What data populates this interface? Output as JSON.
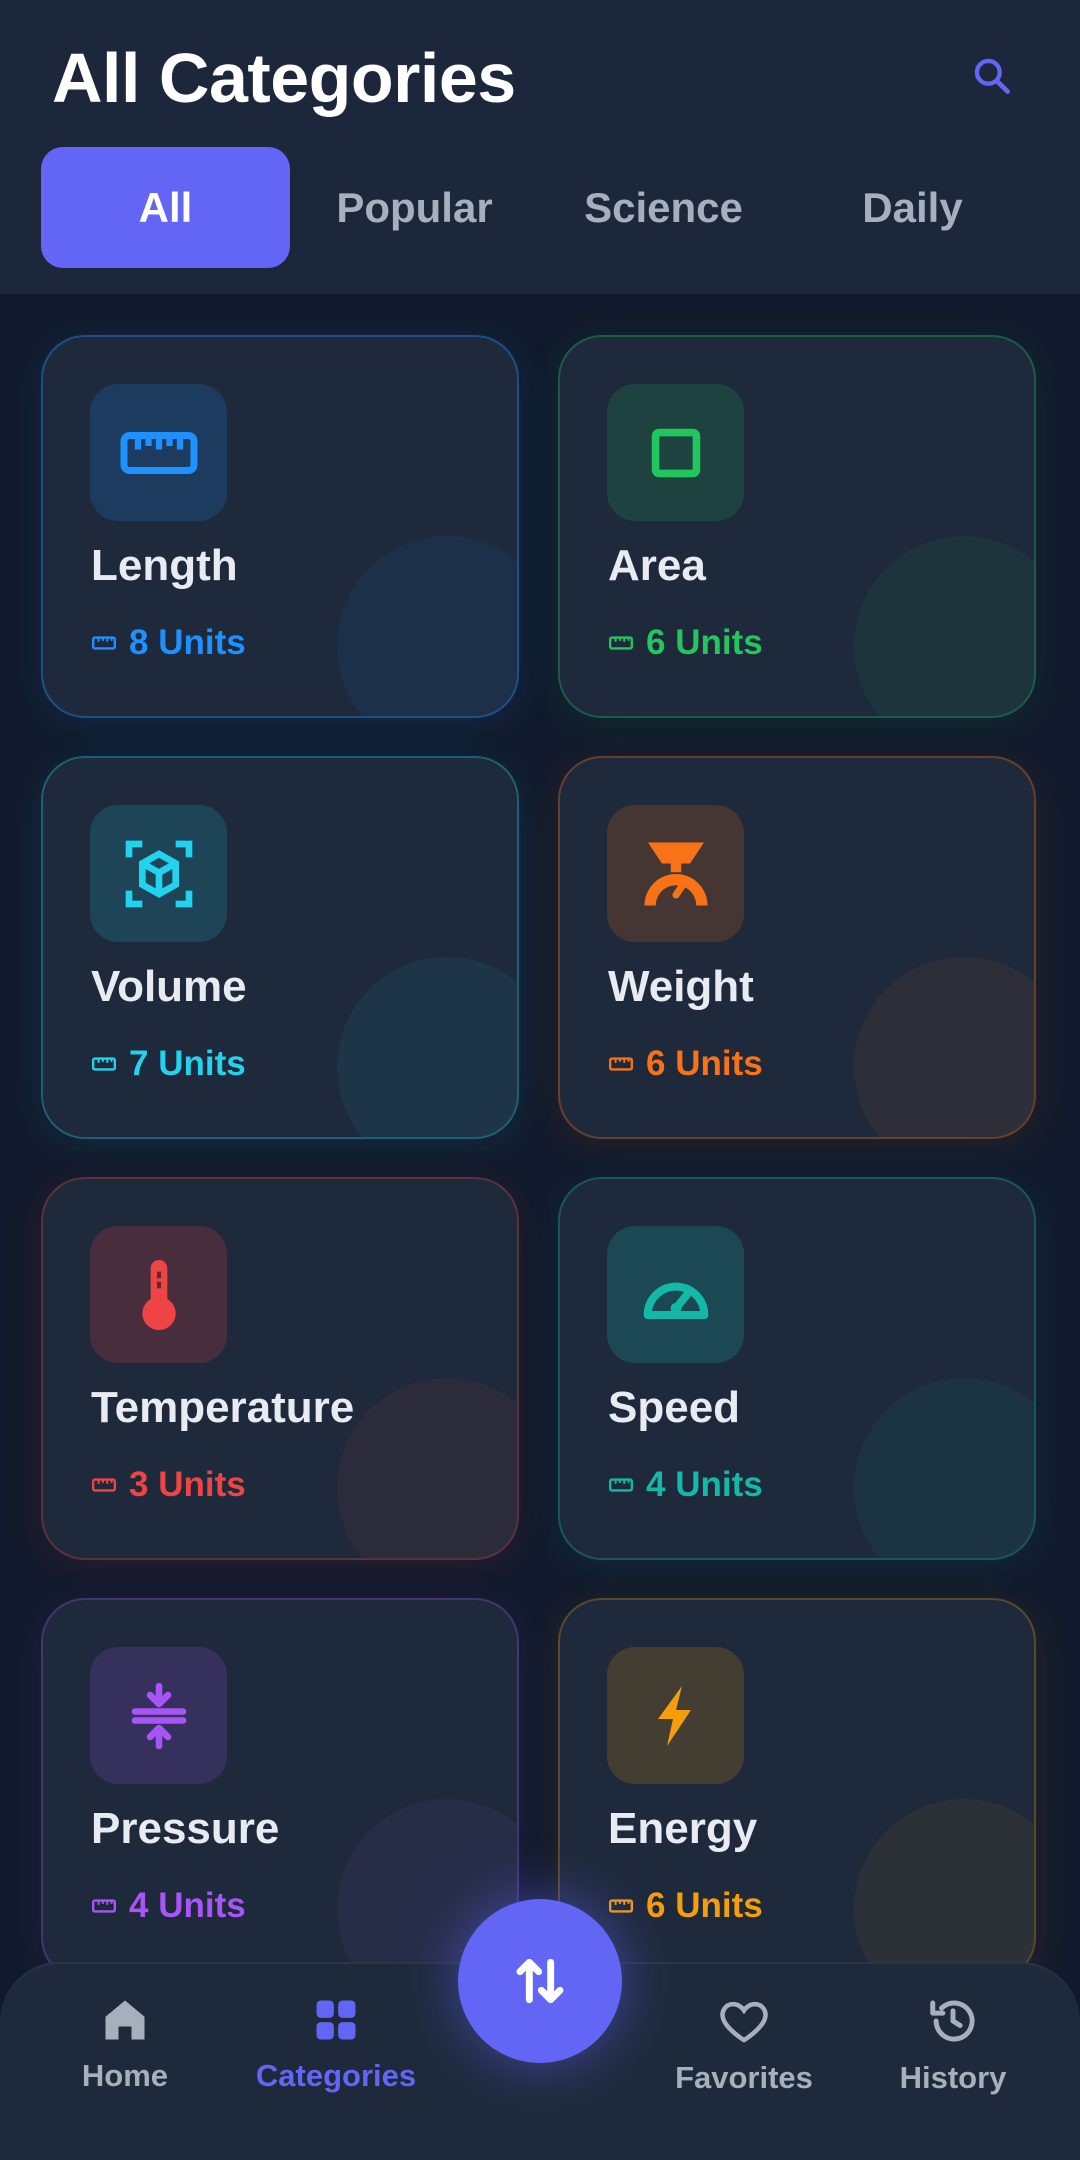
{
  "header": {
    "title": "All Categories",
    "search_icon": "search-icon"
  },
  "tabs": [
    {
      "label": "All",
      "active": true
    },
    {
      "label": "Popular",
      "active": false
    },
    {
      "label": "Science",
      "active": false
    },
    {
      "label": "Daily",
      "active": false
    }
  ],
  "categories": [
    {
      "name": "Length",
      "units": "8 Units",
      "icon": "ruler-icon",
      "color": "#1e90ff"
    },
    {
      "name": "Area",
      "units": "6 Units",
      "icon": "square-icon",
      "color": "#22c55e"
    },
    {
      "name": "Volume",
      "units": "7 Units",
      "icon": "cube-icon",
      "color": "#22d3ee"
    },
    {
      "name": "Weight",
      "units": "6 Units",
      "icon": "scale-icon",
      "color": "#f97316"
    },
    {
      "name": "Temperature",
      "units": "3 Units",
      "icon": "thermometer-icon",
      "color": "#ef4444"
    },
    {
      "name": "Speed",
      "units": "4 Units",
      "icon": "speedometer-icon",
      "color": "#14b8a6"
    },
    {
      "name": "Pressure",
      "units": "4 Units",
      "icon": "compress-icon",
      "color": "#a855f7"
    },
    {
      "name": "Energy",
      "units": "6 Units",
      "icon": "bolt-icon",
      "color": "#f59e0b"
    }
  ],
  "bottom_nav": {
    "items": [
      {
        "label": "Home",
        "icon": "home-icon",
        "active": false
      },
      {
        "label": "Categories",
        "icon": "grid-icon",
        "active": true
      },
      {
        "label": "Favorites",
        "icon": "heart-icon",
        "active": false
      },
      {
        "label": "History",
        "icon": "history-icon",
        "active": false
      }
    ],
    "fab_icon": "swap-arrows-icon"
  },
  "colors": {
    "accent": "#6366f5",
    "background": "#111a2c",
    "card": "#1e293b"
  }
}
